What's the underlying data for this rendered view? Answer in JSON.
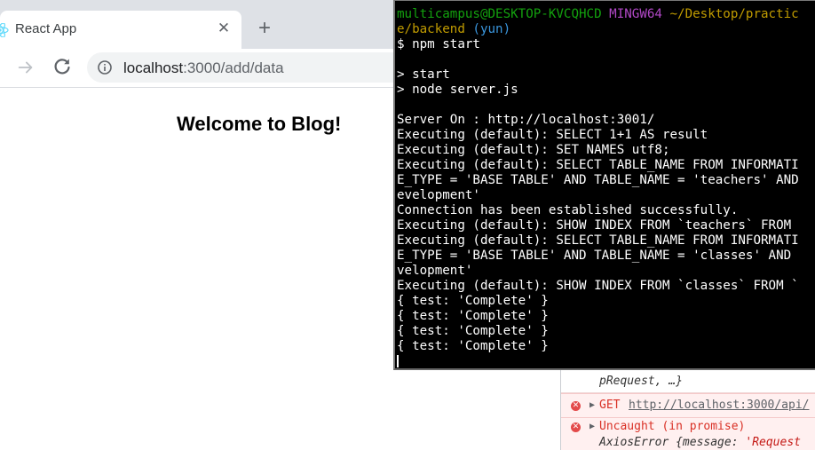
{
  "browser": {
    "tab_title": "React App",
    "tab_close": "✕",
    "new_tab": "+",
    "url_host": "localhost",
    "url_path": ":3000/add/data"
  },
  "page": {
    "heading": "Welcome to Blog!"
  },
  "terminal": {
    "prompt_user": "multicampus@DESKTOP-KVCQHCD",
    "prompt_system": "MINGW64",
    "prompt_path": "~/Desktop/practic",
    "prompt_path_cont": "e/backend",
    "prompt_branch": "(yun)",
    "command": "$ npm start",
    "output": [
      "",
      "> start",
      "> node server.js",
      "",
      "Server On : http://localhost:3001/",
      "Executing (default): SELECT 1+1 AS result",
      "Executing (default): SET NAMES utf8;",
      "Executing (default): SELECT TABLE_NAME FROM INFORMATI",
      "E_TYPE = 'BASE TABLE' AND TABLE_NAME = 'teachers' AND",
      "evelopment'",
      "Connection has been established successfully.",
      "Executing (default): SHOW INDEX FROM `teachers` FROM",
      "Executing (default): SELECT TABLE_NAME FROM INFORMATI",
      "E_TYPE = 'BASE TABLE' AND TABLE_NAME = 'classes' AND",
      "velopment'",
      "Executing (default): SHOW INDEX FROM `classes` FROM `",
      "{ test: 'Complete' }",
      "{ test: 'Complete' }",
      "{ test: 'Complete' }",
      "{ test: 'Complete' }"
    ]
  },
  "console": {
    "partial_line": "pRequest, …}",
    "error1_method": "GET",
    "error1_url": "http://localhost:3000/api/",
    "error2_title": "Uncaught (in promise)",
    "error2_detail_prefix": "AxiosError {message: ",
    "error2_detail_value": "'Request",
    "error_icon": "✕",
    "expand_icon": "▶"
  },
  "colors": {
    "prompt_user": "#13a10e",
    "prompt_system": "#b148c6",
    "prompt_path": "#c19c00",
    "prompt_branch": "#3a96dd",
    "error_text": "#d93025",
    "console_italic": "#333333",
    "console_string": "#c41a16"
  }
}
